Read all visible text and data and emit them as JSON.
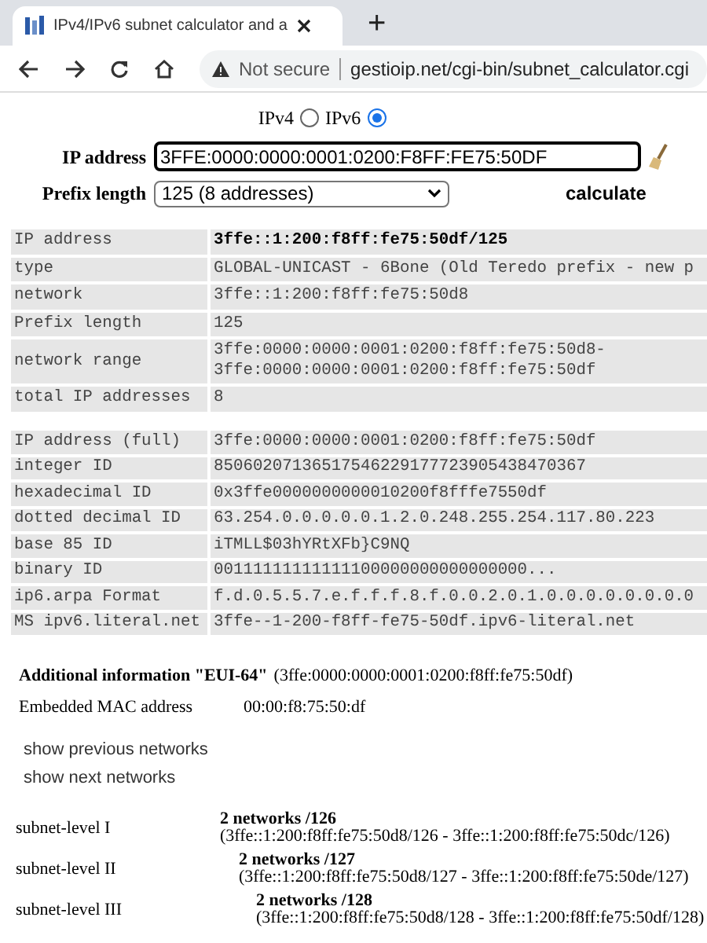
{
  "browser": {
    "tab_title": "IPv4/IPv6 subnet calculator and a",
    "new_tab": "+",
    "security": "Not secure",
    "url": "gestioip.net/cgi-bin/subnet_calculator.cgi"
  },
  "form": {
    "versions": [
      {
        "label": "IPv4",
        "selected": false
      },
      {
        "label": "IPv6",
        "selected": true
      }
    ],
    "ip_label": "IP address",
    "ip_value": "3FFE:0000:0000:0001:0200:F8FF:FE75:50DF",
    "prefix_label": "Prefix length",
    "prefix_value": "125 (8 addresses)",
    "calculate": "calculate"
  },
  "summary_table": [
    {
      "label": "IP address",
      "value": [
        "3ffe::1:200:f8ff:fe75:50df/125"
      ],
      "bold": true
    },
    {
      "label": "type",
      "value": [
        "GLOBAL-UNICAST - 6Bone (Old Teredo prefix - new p"
      ],
      "bold": false
    },
    {
      "label": "network",
      "value": [
        "3ffe::1:200:f8ff:fe75:50d8"
      ],
      "bold": false
    },
    {
      "label": "Prefix length",
      "value": [
        "125"
      ],
      "bold": false
    },
    {
      "label": "network range",
      "value": [
        "3ffe:0000:0000:0001:0200:f8ff:fe75:50d8-",
        "3ffe:0000:0000:0001:0200:f8ff:fe75:50df"
      ],
      "bold": false
    },
    {
      "label": "total IP addresses",
      "value": [
        "8"
      ],
      "bold": false
    }
  ],
  "id_table": [
    {
      "label": "IP address (full)",
      "value": "3ffe:0000:0000:0001:0200:f8ff:fe75:50df"
    },
    {
      "label": "integer ID",
      "value": "85060207136517546229177723905438470367"
    },
    {
      "label": "hexadecimal ID",
      "value": "0x3ffe0000000000010200f8fffe7550df"
    },
    {
      "label": "dotted decimal ID",
      "value": "63.254.0.0.0.0.0.1.2.0.248.255.254.117.80.223"
    },
    {
      "label": "base 85 ID",
      "value": "iTMLL$03hYRtXFb}C9NQ"
    },
    {
      "label": "binary ID",
      "value": "00111111111111100000000000000000..."
    },
    {
      "label": "ip6.arpa Format",
      "value": "f.d.0.5.5.7.e.f.f.f.8.f.0.0.2.0.1.0.0.0.0.0.0.0.0"
    },
    {
      "label": "MS ipv6.literal.net",
      "value": "3ffe--1-200-f8ff-fe75-50df.ipv6-literal.net"
    }
  ],
  "additional": {
    "title": "Additional information \"EUI-64\"",
    "address": "(3ffe:0000:0000:0001:0200:f8ff:fe75:50df)",
    "mac_label": "Embedded MAC address",
    "mac_value": "00:00:f8:75:50:df"
  },
  "links": [
    "show previous networks",
    "show next networks"
  ],
  "subnets": [
    {
      "label": "subnet-level I",
      "title": "2 networks /126",
      "range": "(3ffe::1:200:f8ff:fe75:50d8/126 - 3ffe::1:200:f8ff:fe75:50dc/126)"
    },
    {
      "label": "subnet-level II",
      "title": "2 networks /127",
      "range": "(3ffe::1:200:f8ff:fe75:50d8/127 - 3ffe::1:200:f8ff:fe75:50de/127)"
    },
    {
      "label": "subnet-level III",
      "title": "2 networks /128",
      "range": "(3ffe::1:200:f8ff:fe75:50d8/128 - 3ffe::1:200:f8ff:fe75:50df/128)"
    }
  ]
}
